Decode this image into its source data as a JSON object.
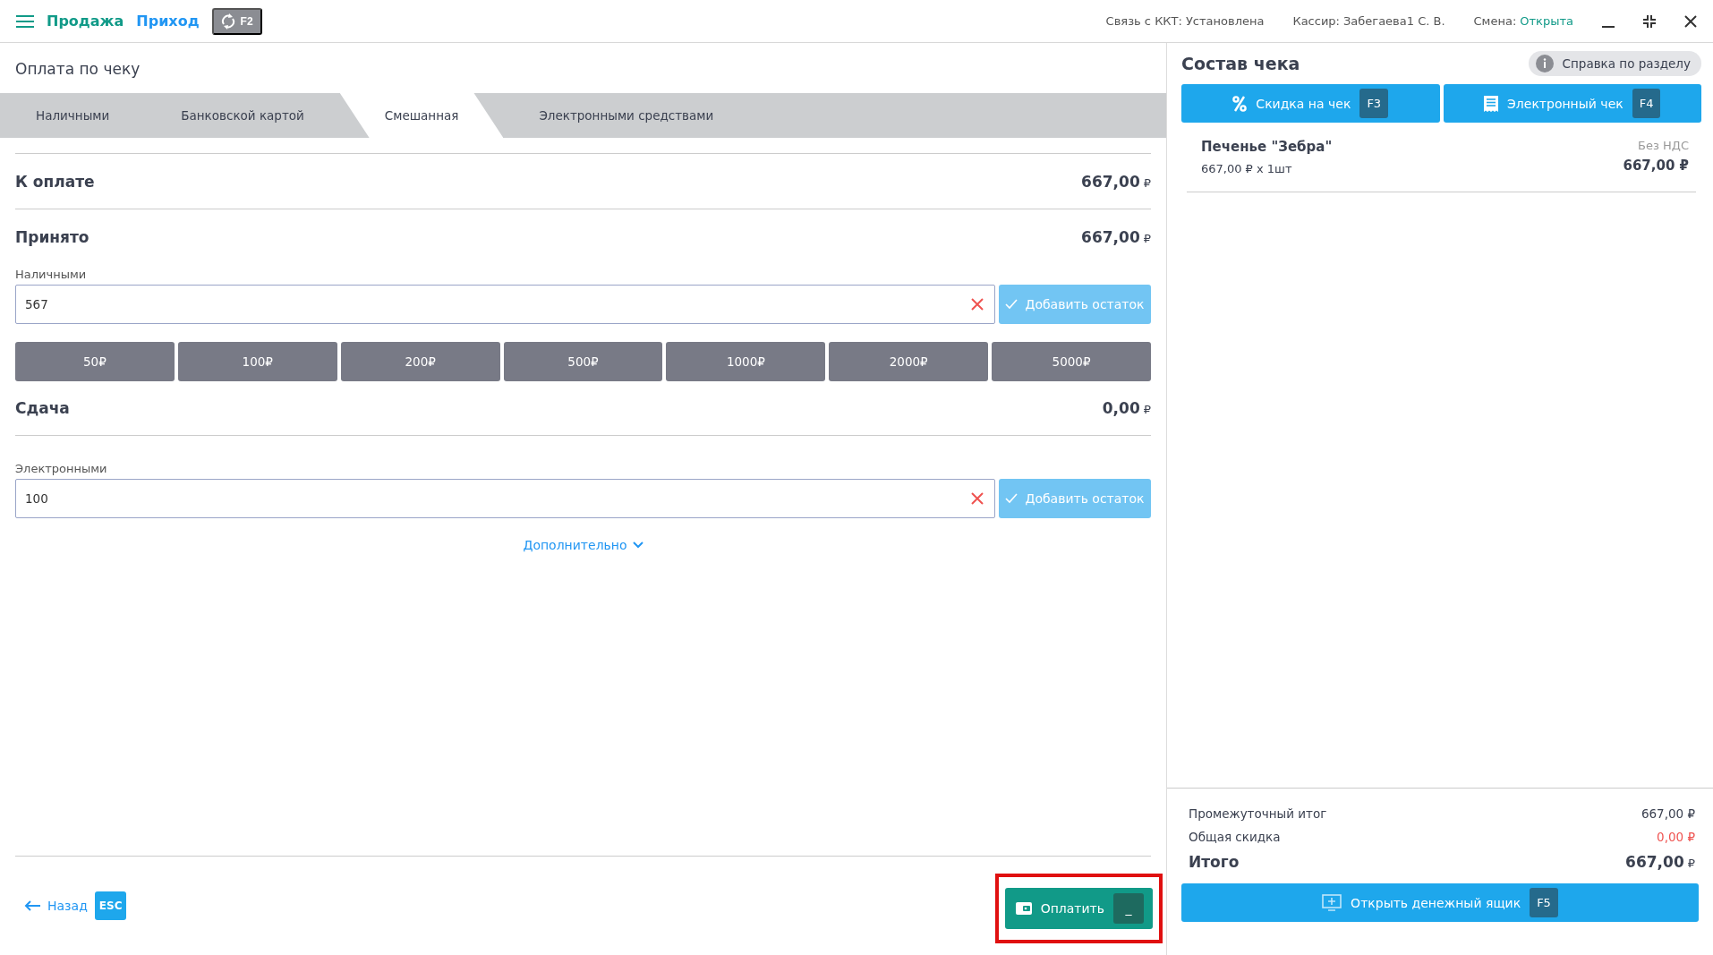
{
  "topbar": {
    "menu_links": [
      {
        "label": "Продажа",
        "selected": true
      },
      {
        "label": "Приход",
        "selected": false
      }
    ],
    "sync_key": "F2",
    "status": [
      {
        "label": "Связь с ККТ:",
        "value": "Установлена",
        "highlight": false
      },
      {
        "label": "Кассир:",
        "value": "Забегаева1 С. В.",
        "highlight": false
      },
      {
        "label": "Смена:",
        "value": "Открыта",
        "highlight": true
      }
    ]
  },
  "payment": {
    "title": "Оплата по чеку",
    "tabs": [
      {
        "label": "Наличными",
        "selected": false
      },
      {
        "label": "Банковской картой",
        "selected": false
      },
      {
        "label": "Смешанная",
        "selected": true
      },
      {
        "label": "Электронными средствами",
        "selected": false
      }
    ],
    "to_pay": {
      "label": "К оплате",
      "amount": "667,00",
      "currency": "₽"
    },
    "received": {
      "label": "Принято",
      "amount": "667,00",
      "currency": "₽"
    },
    "cash": {
      "label": "Наличными",
      "value": "567",
      "add_rest": "Добавить остаток"
    },
    "denominations": [
      "50₽",
      "100₽",
      "200₽",
      "500₽",
      "1000₽",
      "2000₽",
      "5000₽"
    ],
    "change": {
      "label": "Сдача",
      "amount": "0,00",
      "currency": "₽"
    },
    "electronic": {
      "label": "Электронными",
      "value": "100",
      "add_rest": "Добавить остаток"
    },
    "more": "Дополнительно",
    "back": {
      "label": "Назад",
      "key": "ESC"
    },
    "pay": {
      "label": "Оплатить",
      "key": "_",
      "highlighted": true
    }
  },
  "receipt": {
    "title": "Состав чека",
    "help": "Справка по разделу",
    "actions": [
      {
        "kind": "percent",
        "label": "Скидка на чек",
        "key": "F3"
      },
      {
        "kind": "receipt",
        "label": "Электронный чек",
        "key": "F4"
      }
    ],
    "items": [
      {
        "name": "Печенье \"Зебра\"",
        "qty": "667,00 ₽ x 1шт",
        "vat": "Без НДС",
        "total": "667,00 ₽"
      }
    ],
    "subtotal": {
      "label": "Промежуточный итог",
      "value": "667,00 ₽"
    },
    "discount": {
      "label": "Общая скидка",
      "value": "0,00 ₽"
    },
    "total": {
      "label": "Итого",
      "amount": "667,00",
      "currency": "₽"
    },
    "drawer": {
      "label": "Открыть денежный ящик",
      "key": "F5"
    }
  }
}
